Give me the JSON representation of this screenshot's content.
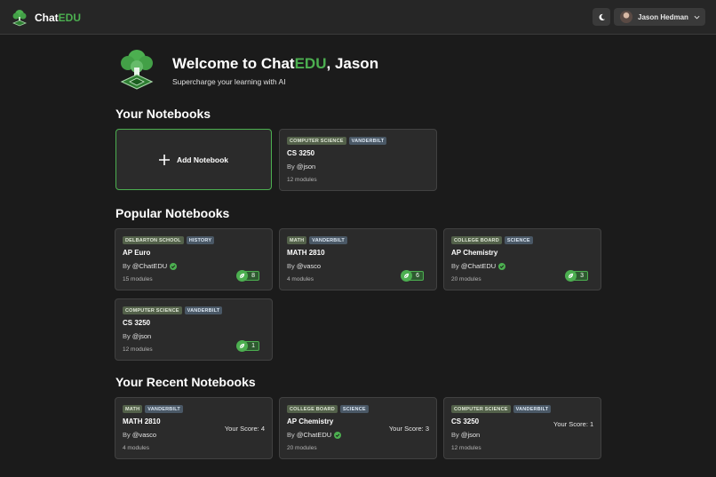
{
  "header": {
    "brand_prefix": "Chat",
    "brand_accent": "EDU",
    "user_name": "Jason Hedman",
    "icons": {
      "logo": "tree-chip-logo",
      "theme": "moon-icon",
      "menu": "chevron-down-icon"
    }
  },
  "hero": {
    "welcome_pre": "Welcome to Chat",
    "welcome_accent": "EDU",
    "welcome_post": ", Jason",
    "tagline": "Supercharge your learning with AI"
  },
  "sections": {
    "your_notebooks": "Your Notebooks",
    "popular_notebooks": "Popular Notebooks",
    "recent_notebooks": "Your Recent Notebooks"
  },
  "add_notebook_label": "Add Notebook",
  "your_notebooks": [
    {
      "tags": [
        "COMPUTER SCIENCE",
        "VANDERBILT"
      ],
      "title": "CS 3250",
      "by": "By",
      "handle": "@json",
      "verified": false,
      "modules": "12 modules"
    }
  ],
  "popular_notebooks": [
    {
      "tags": [
        "DELBARTON SCHOOL",
        "HISTORY"
      ],
      "title": "AP Euro",
      "by": "By",
      "handle": "@ChatEDU",
      "verified": true,
      "modules": "15 modules",
      "count": "8"
    },
    {
      "tags": [
        "MATH",
        "VANDERBILT"
      ],
      "title": "MATH 2810",
      "by": "By",
      "handle": "@vasco",
      "verified": false,
      "modules": "4 modules",
      "count": "6"
    },
    {
      "tags": [
        "COLLEGE BOARD",
        "SCIENCE"
      ],
      "title": "AP Chemistry",
      "by": "By",
      "handle": "@ChatEDU",
      "verified": true,
      "modules": "20 modules",
      "count": "3"
    },
    {
      "tags": [
        "COMPUTER SCIENCE",
        "VANDERBILT"
      ],
      "title": "CS 3250",
      "by": "By",
      "handle": "@json",
      "verified": false,
      "modules": "12 modules",
      "count": "1"
    }
  ],
  "recent_notebooks": [
    {
      "tags": [
        "MATH",
        "VANDERBILT"
      ],
      "title": "MATH 2810",
      "by": "By",
      "handle": "@vasco",
      "verified": false,
      "modules": "4 modules",
      "score": "Your Score: 4"
    },
    {
      "tags": [
        "COLLEGE BOARD",
        "SCIENCE"
      ],
      "title": "AP Chemistry",
      "by": "By",
      "handle": "@ChatEDU",
      "verified": true,
      "modules": "20 modules",
      "score": "Your Score: 3"
    },
    {
      "tags": [
        "COMPUTER SCIENCE",
        "VANDERBILT"
      ],
      "title": "CS 3250",
      "by": "By",
      "handle": "@json",
      "verified": false,
      "modules": "12 modules",
      "score": "Your Score: 1"
    }
  ],
  "colors": {
    "accent": "#4caf50",
    "background": "#1b1b1b",
    "card": "#2b2b2b"
  }
}
